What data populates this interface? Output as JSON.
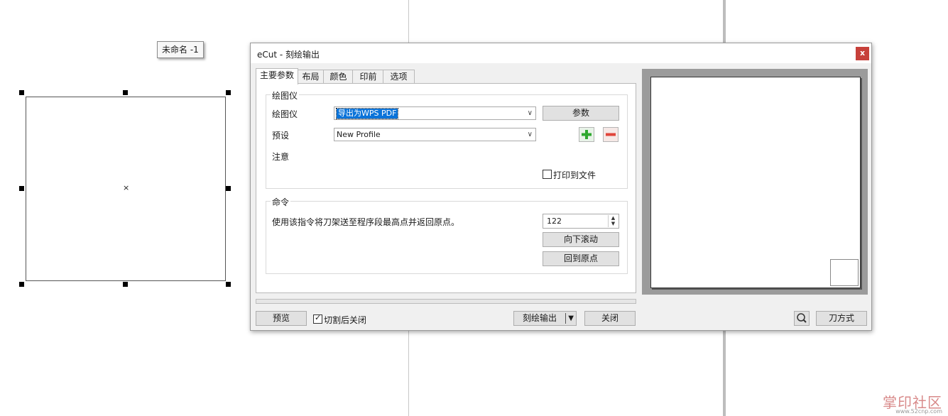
{
  "canvas": {
    "object_label": "未命名 -1",
    "center_mark": "×"
  },
  "dialog": {
    "title": "eCut - 刻绘输出",
    "close": "x",
    "tabs": [
      "主要参数",
      "布局",
      "颜色",
      "印前",
      "选项"
    ],
    "plotter_group": {
      "title": "绘图仪",
      "plotter_label": "绘图仪",
      "plotter_value": "导出为WPS PDF",
      "params_button": "参数",
      "preset_label": "预设",
      "preset_value": "New Profile",
      "note_label": "注意",
      "print_to_file_label": "打印到文件",
      "print_to_file_checked": false
    },
    "command_group": {
      "title": "命令",
      "description": "使用该指令将刀架送至程序段最高点并返回原点。",
      "spin_value": "122",
      "scroll_down_button": "向下滚动",
      "return_origin_button": "回到原点"
    },
    "footer": {
      "preview_button": "预览",
      "close_after_cut_label": "切割后关闭",
      "close_after_cut_checked": true,
      "output_button": "刻绘输出",
      "close_button": "关闭",
      "knife_mode_button": "刀方式"
    }
  },
  "watermark": {
    "text": "掌印社区",
    "url": "www.52cnp.com"
  },
  "colors": {
    "close_red": "#c7403a",
    "selection_blue": "#0a73d9",
    "add_green": "#2ea82e",
    "remove_red": "#e0443a"
  }
}
